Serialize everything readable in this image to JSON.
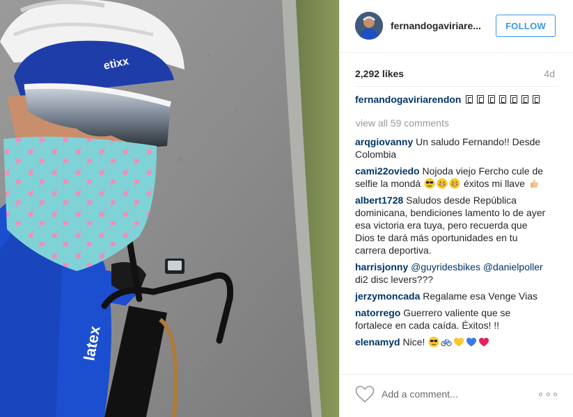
{
  "post": {
    "header": {
      "username": "fernandogaviriare...",
      "follow_label": "FOLLOW"
    },
    "stats": {
      "likes": "2,292 likes",
      "age": "4d"
    },
    "caption": {
      "author": "fernandogaviriarendon",
      "glyph_count": 7
    },
    "view_all_label": "view all 59 comments",
    "comments": [
      {
        "author": "arqgiovanny",
        "text": "Un saludo Fernando!! Desde Colombia"
      },
      {
        "author": "cami22oviedo",
        "text": "Nojoda viejo Fercho cule de selfie la mondá",
        "emojis": [
          "sunglasses-emoji",
          "grin-emoji",
          "grin-emoji"
        ],
        "text_after": "éxitos mi llave",
        "emojis_after": [
          "thumbs-up-emoji"
        ]
      },
      {
        "author": "albert1728",
        "text": "Saludos desde República dominicana, bendiciones lamento lo de ayer esa victoria era tuya, pero recuerda que Dios te dará más oportunidades en tu carrera deportiva."
      },
      {
        "author": "harrisjonny",
        "mention1": "@guyridesbikes",
        "mention2": "@danielpoller",
        "text": "di2 disc levers???"
      },
      {
        "author": "jerzymoncada",
        "text": "Regalame esa Venge Vias"
      },
      {
        "author": "natorrego",
        "text": "Guerrero valiente que se fortalece en cada caída. Éxitos! !!"
      },
      {
        "author": "elenamyd",
        "text": "Nice!",
        "emojis": [
          "sunglasses-emoji",
          "bicycle-emoji",
          "yellow-heart-emoji",
          "blue-heart-emoji",
          "red-heart-emoji"
        ]
      }
    ],
    "footer": {
      "comment_placeholder": "Add a comment..."
    },
    "colors": {
      "accent": "#3897f0",
      "username": "#003569",
      "muted": "#999999",
      "text": "#262626"
    },
    "icons": [
      "heart-icon",
      "more-options-icon"
    ]
  }
}
